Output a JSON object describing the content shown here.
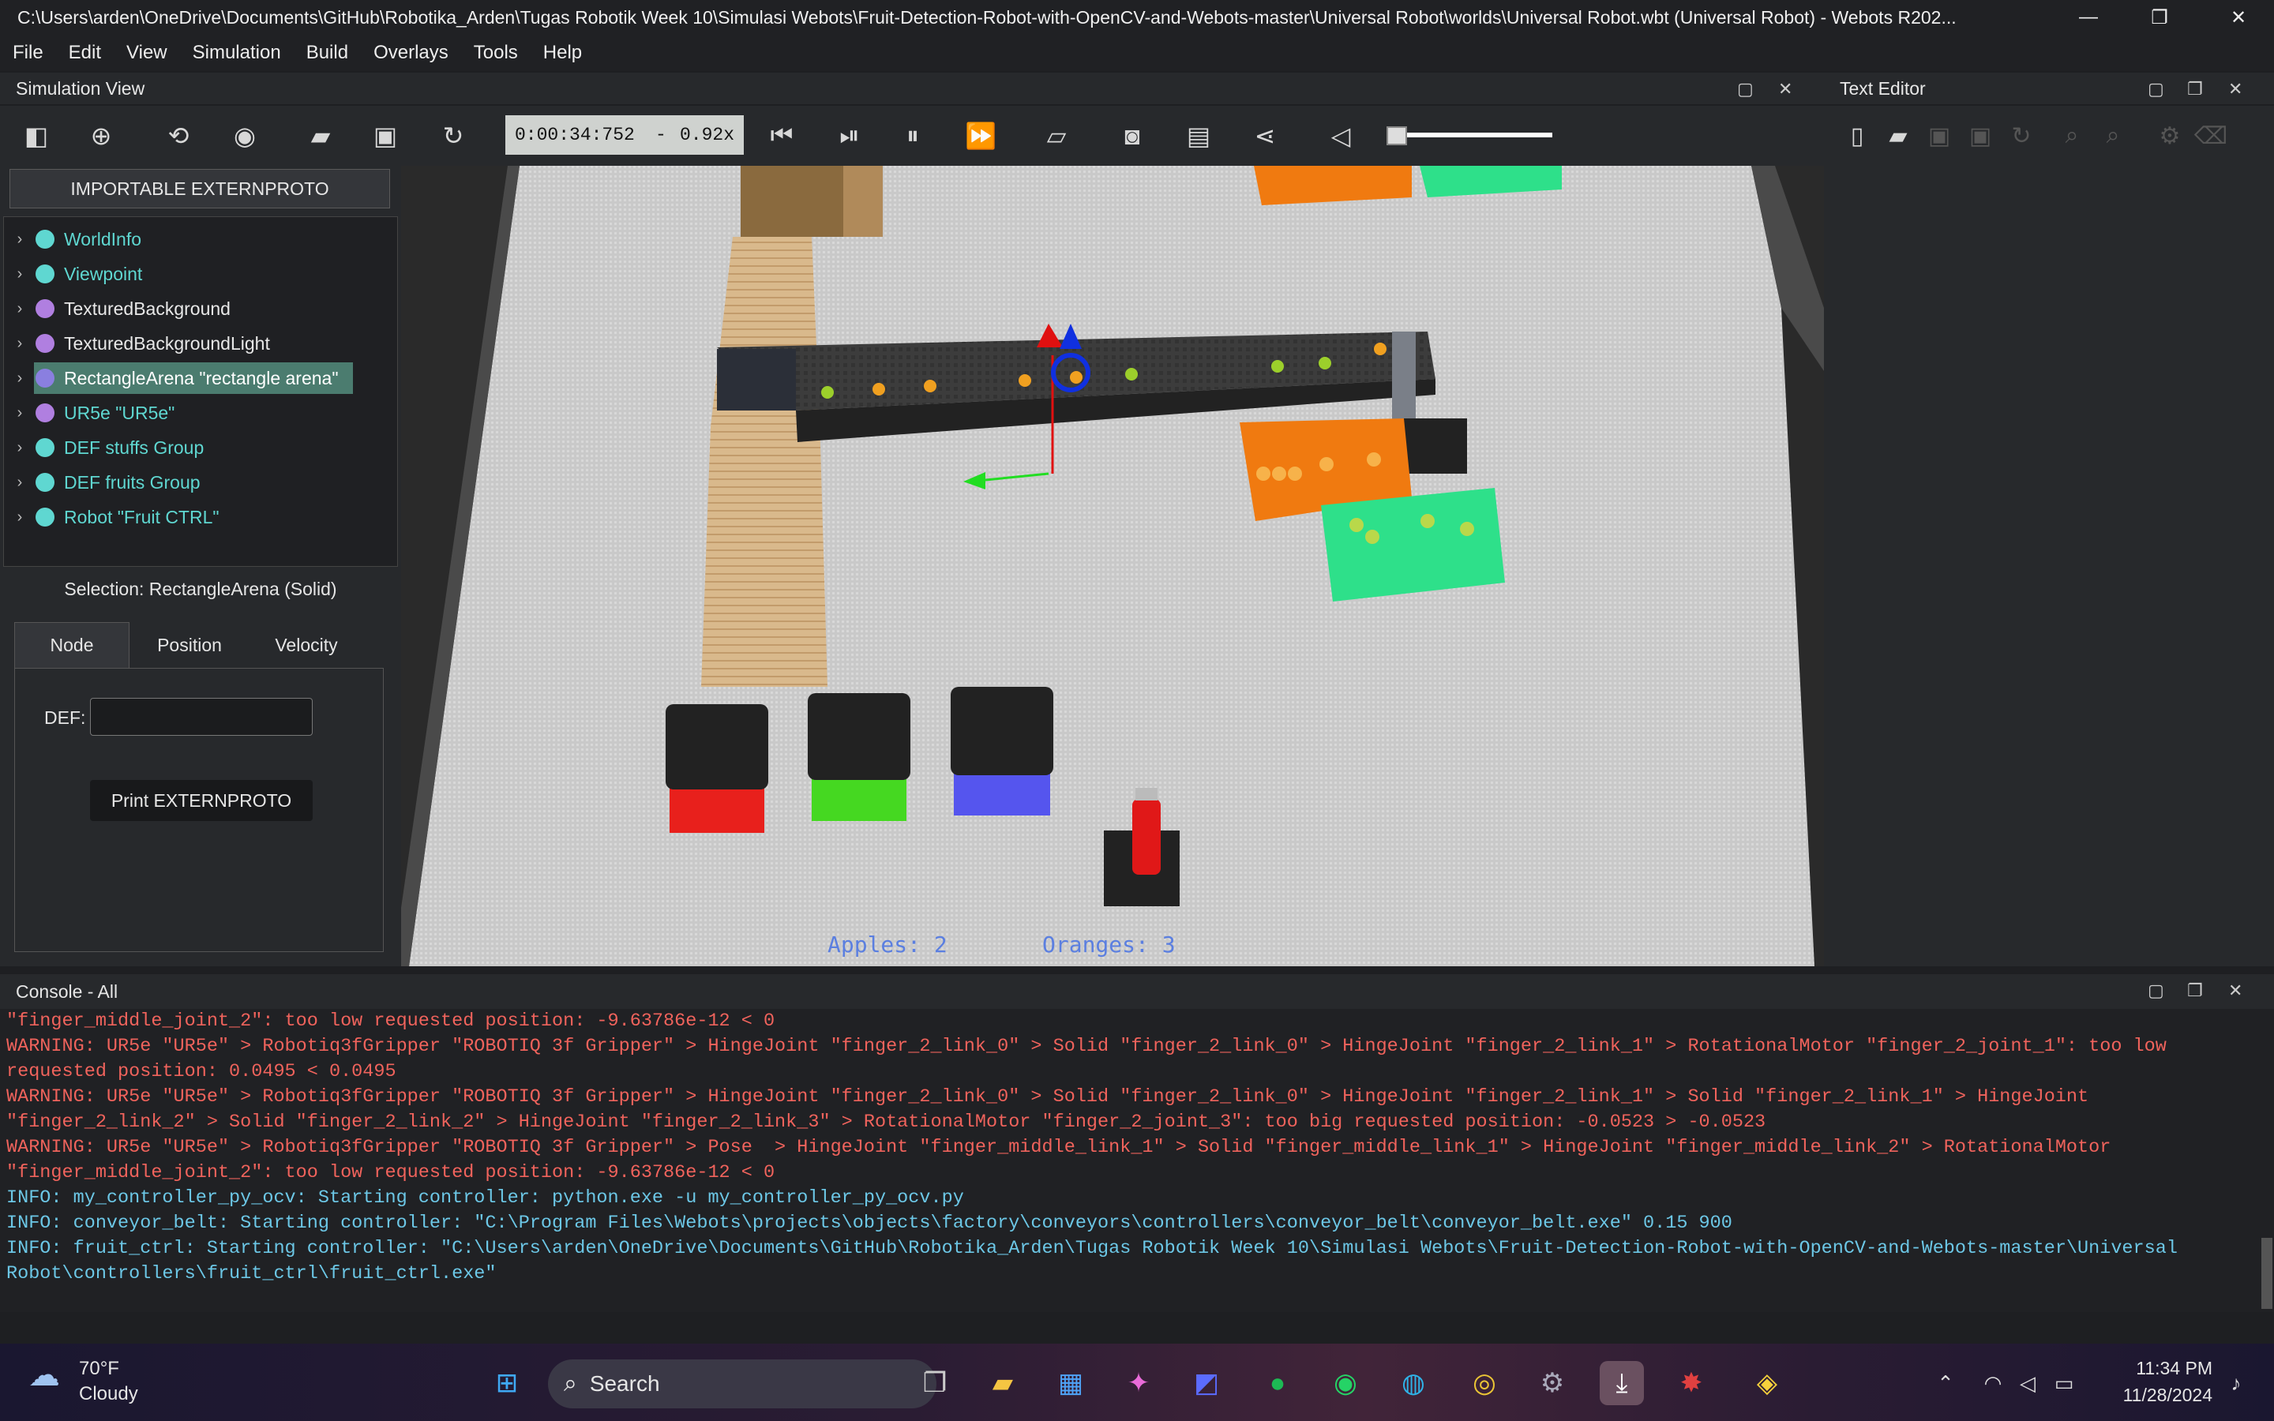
{
  "window": {
    "title": "C:\\Users\\arden\\OneDrive\\Documents\\GitHub\\Robotika_Arden\\Tugas Robotik Week 10\\Simulasi Webots\\Fruit-Detection-Robot-with-OpenCV-and-Webots-master\\Universal Robot\\worlds\\Universal Robot.wbt (Universal Robot) - Webots R202..."
  },
  "menu": [
    "File",
    "Edit",
    "View",
    "Simulation",
    "Build",
    "Overlays",
    "Tools",
    "Help"
  ],
  "sim_view": {
    "title": "Simulation View",
    "time": "0:00:34:752",
    "dash": "-",
    "speed": "0.92x"
  },
  "text_editor": {
    "title": "Text Editor"
  },
  "scene": {
    "proto_button": "IMPORTABLE EXTERNPROTO",
    "nodes": [
      {
        "label": "WorldInfo",
        "color": "#5fd7d1"
      },
      {
        "label": "Viewpoint",
        "color": "#5fd7d1"
      },
      {
        "label": "TexturedBackground",
        "color": "#b07fe0"
      },
      {
        "label": "TexturedBackgroundLight",
        "color": "#b07fe0"
      },
      {
        "label": "RectangleArena \"rectangle arena\"",
        "color": "#8a7fe0"
      },
      {
        "label": "UR5e \"UR5e\"",
        "color": "#b07fe0"
      },
      {
        "label": "DEF stuffs Group",
        "color": "#5fd7d1"
      },
      {
        "label": "DEF fruits Group",
        "color": "#5fd7d1"
      },
      {
        "label": "Robot \"Fruit CTRL\"",
        "color": "#5fd7d1"
      }
    ],
    "selection": "Selection: RectangleArena (Solid)",
    "tabs": [
      "Node",
      "Position",
      "Velocity"
    ],
    "def_label": "DEF:",
    "def_value": "",
    "print_button": "Print EXTERNPROTO"
  },
  "overlay": {
    "apples": "Apples: 2",
    "oranges": "Oranges: 3"
  },
  "console": {
    "title": "Console - All",
    "lines": [
      {
        "type": "warn",
        "text": "\"finger_middle_joint_2\": too low requested position: -9.63786e-12 < 0"
      },
      {
        "type": "warn",
        "text": "WARNING: UR5e \"UR5e\" > Robotiq3fGripper \"ROBOTIQ 3f Gripper\" > HingeJoint \"finger_2_link_0\" > Solid \"finger_2_link_0\" > HingeJoint \"finger_2_link_1\" > RotationalMotor \"finger_2_joint_1\": too low"
      },
      {
        "type": "warn",
        "text": "requested position: 0.0495 < 0.0495"
      },
      {
        "type": "warn",
        "text": "WARNING: UR5e \"UR5e\" > Robotiq3fGripper \"ROBOTIQ 3f Gripper\" > HingeJoint \"finger_2_link_0\" > Solid \"finger_2_link_0\" > HingeJoint \"finger_2_link_1\" > Solid \"finger_2_link_1\" > HingeJoint"
      },
      {
        "type": "warn",
        "text": "\"finger_2_link_2\" > Solid \"finger_2_link_2\" > HingeJoint \"finger_2_link_3\" > RotationalMotor \"finger_2_joint_3\": too big requested position: -0.0523 > -0.0523"
      },
      {
        "type": "warn",
        "text": "WARNING: UR5e \"UR5e\" > Robotiq3fGripper \"ROBOTIQ 3f Gripper\" > Pose  > HingeJoint \"finger_middle_link_1\" > Solid \"finger_middle_link_1\" > HingeJoint \"finger_middle_link_2\" > RotationalMotor"
      },
      {
        "type": "warn",
        "text": "\"finger_middle_joint_2\": too low requested position: -9.63786e-12 < 0"
      },
      {
        "type": "info",
        "text": "INFO: my_controller_py_ocv: Starting controller: python.exe -u my_controller_py_ocv.py"
      },
      {
        "type": "info",
        "text": "INFO: conveyor_belt: Starting controller: \"C:\\Program Files\\Webots\\projects\\objects\\factory\\conveyors\\controllers\\conveyor_belt\\conveyor_belt.exe\" 0.15 900"
      },
      {
        "type": "info",
        "text": "INFO: fruit_ctrl: Starting controller: \"C:\\Users\\arden\\OneDrive\\Documents\\GitHub\\Robotika_Arden\\Tugas Robotik Week 10\\Simulasi Webots\\Fruit-Detection-Robot-with-OpenCV-and-Webots-master\\Universal"
      },
      {
        "type": "info",
        "text": "Robot\\controllers\\fruit_ctrl\\fruit_ctrl.exe\""
      }
    ]
  },
  "taskbar": {
    "temp": "70°F",
    "weather": "Cloudy",
    "search": "Search",
    "time": "11:34 PM",
    "date": "11/28/2024"
  }
}
